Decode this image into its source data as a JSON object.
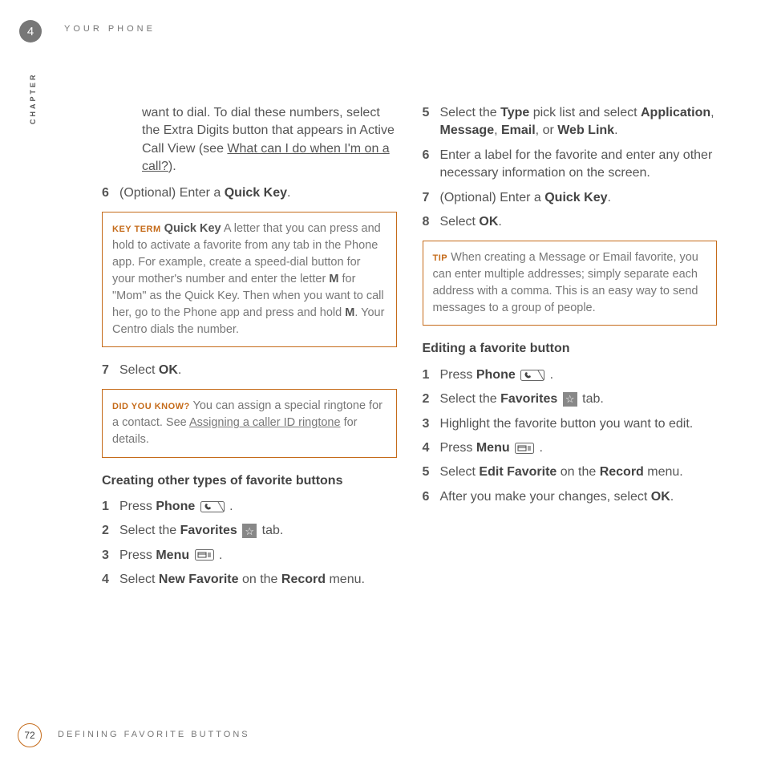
{
  "chapter": {
    "label": "CHAPTER",
    "number": "4"
  },
  "header": "YOUR PHONE",
  "footer": {
    "page": "72",
    "text": "DEFINING FAVORITE BUTTONS"
  },
  "col1": {
    "intro_a": "want to dial. To dial these numbers, select the Extra Digits button that appears in Active Call View (see ",
    "intro_link": "What can I do when I'm on a call?",
    "intro_b": ").",
    "step6_a": "(Optional)  Enter a ",
    "step6_b": "Quick Key",
    "step6_c": ".",
    "keyterm_label": "KEY TERM",
    "keyterm_title": "Quick Key",
    "keyterm_body_a": "   A letter that you can press and hold to activate a favorite from any tab in the Phone app. For example, create a speed-dial button for your mother's number and enter the letter ",
    "keyterm_body_b": "M",
    "keyterm_body_c": " for \"Mom\" as the Quick Key. Then when you want to call her, go to the Phone app and press and hold ",
    "keyterm_body_d": "M",
    "keyterm_body_e": ". Your Centro dials the number.",
    "step7_a": "Select ",
    "step7_b": "OK",
    "step7_c": ".",
    "dyk_label": "DID YOU KNOW?",
    "dyk_a": "  You can assign a special ringtone for a contact. See ",
    "dyk_link": "Assigning a caller ID ringtone",
    "dyk_b": " for details.",
    "section": "Creating other types of favorite buttons",
    "s1_a": "Press ",
    "s1_b": "Phone ",
    "s2_a": "Select the ",
    "s2_b": "Favorites ",
    "s2_c": " tab.",
    "s3_a": "Press ",
    "s3_b": "Menu ",
    "s4_a": "Select ",
    "s4_b": "New Favorite",
    "s4_c": " on the ",
    "s4_d": "Record",
    "s4_e": " menu."
  },
  "col2": {
    "s5_a": "Select the ",
    "s5_b": "Type",
    "s5_c": " pick list and select ",
    "s5_d": "Application",
    "s5_e": ", ",
    "s5_f": "Message",
    "s5_g": ", ",
    "s5_h": "Email",
    "s5_i": ", or ",
    "s5_j": "Web Link",
    "s5_k": ".",
    "s6": "Enter a label for the favorite and enter any other necessary information on the  screen.",
    "s7_a": "(Optional)  Enter a ",
    "s7_b": "Quick Key",
    "s7_c": ".",
    "s8_a": "Select ",
    "s8_b": "OK",
    "s8_c": ".",
    "tip_label": "TIP",
    "tip_body": "  When creating a Message or Email favorite, you can enter multiple addresses; simply separate each address with a comma. This is an easy way to send messages to a group of people.",
    "section": "Editing a favorite button",
    "e1_a": "Press ",
    "e1_b": "Phone ",
    "e2_a": "Select the ",
    "e2_b": "Favorites ",
    "e2_c": " tab.",
    "e3": "Highlight the favorite button you want to edit.",
    "e4_a": "Press ",
    "e4_b": "Menu ",
    "e5_a": "Select ",
    "e5_b": "Edit Favorite",
    "e5_c": " on the ",
    "e5_d": "Record",
    "e5_e": " menu.",
    "e6_a": "After you make your changes, select ",
    "e6_b": "OK",
    "e6_c": "."
  },
  "nums": {
    "n1": "1",
    "n2": "2",
    "n3": "3",
    "n4": "4",
    "n5": "5",
    "n6": "6",
    "n7": "7",
    "n8": "8"
  }
}
